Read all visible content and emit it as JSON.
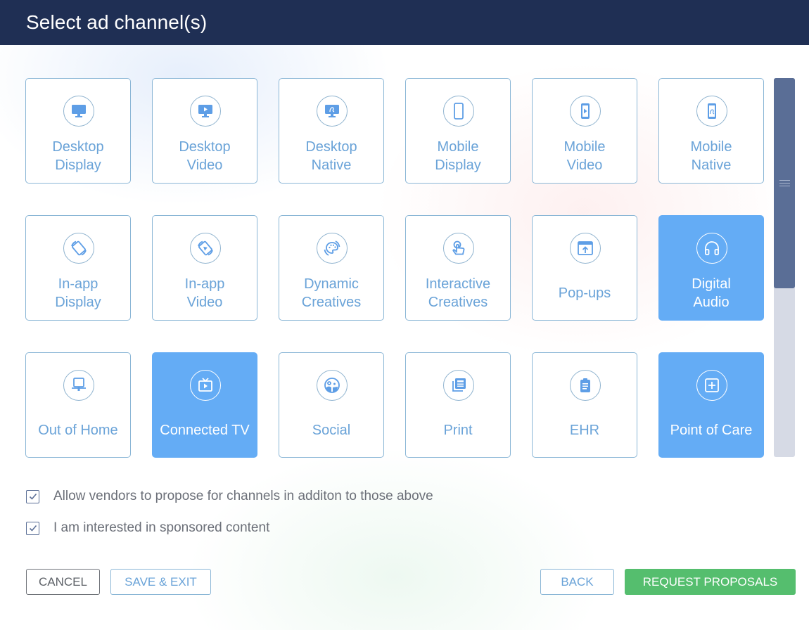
{
  "header": {
    "title": "Select ad channel(s)"
  },
  "colors": {
    "header_bg": "#1f2f54",
    "tile_text": "#6aa3d8",
    "tile_selected_bg": "#64acf5",
    "primary_button": "#55be6e",
    "scroll_thumb": "#5a6e96"
  },
  "channels": [
    {
      "label_line1": "Desktop",
      "label_line2": "Display",
      "icon": "desktop-monitor-icon",
      "selected": false
    },
    {
      "label_line1": "Desktop",
      "label_line2": "Video",
      "icon": "desktop-video-icon",
      "selected": false
    },
    {
      "label_line1": "Desktop",
      "label_line2": "Native",
      "icon": "desktop-native-icon",
      "selected": false
    },
    {
      "label_line1": "Mobile",
      "label_line2": "Display",
      "icon": "mobile-phone-icon",
      "selected": false
    },
    {
      "label_line1": "Mobile",
      "label_line2": "Video",
      "icon": "mobile-video-icon",
      "selected": false
    },
    {
      "label_line1": "Mobile",
      "label_line2": "Native",
      "icon": "mobile-native-icon",
      "selected": false
    },
    {
      "label_line1": "In-app",
      "label_line2": "Display",
      "icon": "rotate-device-icon",
      "selected": false
    },
    {
      "label_line1": "In-app",
      "label_line2": "Video",
      "icon": "rotate-device-video-icon",
      "selected": false
    },
    {
      "label_line1": "Dynamic",
      "label_line2": "Creatives",
      "icon": "palette-icon",
      "selected": false
    },
    {
      "label_line1": "Interactive",
      "label_line2": "Creatives",
      "icon": "touch-hand-icon",
      "selected": false
    },
    {
      "label_line1": "Pop-ups",
      "label_line2": "",
      "icon": "popup-window-icon",
      "selected": false
    },
    {
      "label_line1": "Digital",
      "label_line2": "Audio",
      "icon": "headphones-icon",
      "selected": true
    },
    {
      "label_line1": "Out of Home",
      "label_line2": "",
      "icon": "billboard-icon",
      "selected": false
    },
    {
      "label_line1": "Connected TV",
      "label_line2": "",
      "icon": "tv-icon",
      "selected": true
    },
    {
      "label_line1": "Social",
      "label_line2": "",
      "icon": "social-faces-icon",
      "selected": false
    },
    {
      "label_line1": "Print",
      "label_line2": "",
      "icon": "newspaper-icon",
      "selected": false
    },
    {
      "label_line1": "EHR",
      "label_line2": "",
      "icon": "clipboard-icon",
      "selected": false
    },
    {
      "label_line1": "Point of Care",
      "label_line2": "",
      "icon": "medical-plus-icon",
      "selected": true
    }
  ],
  "options": {
    "allow_vendors": {
      "label": "Allow vendors to propose for channels in additon to those above",
      "checked": true
    },
    "sponsored_content": {
      "label": "I am interested in sponsored content",
      "checked": true
    }
  },
  "buttons": {
    "cancel": "CANCEL",
    "save_exit": "SAVE & EXIT",
    "back": "BACK",
    "request_proposals": "REQUEST PROPOSALS"
  }
}
